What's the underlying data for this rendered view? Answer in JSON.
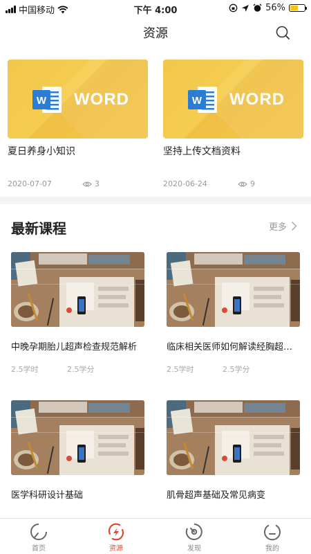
{
  "status_bar": {
    "carrier": "中国移动",
    "time": "下午 4:00",
    "battery_percent": "56%",
    "battery_level": 0.56
  },
  "nav": {
    "title": "资源",
    "search_icon": "search-icon"
  },
  "resources": [
    {
      "thumb_label": "WORD",
      "title": "夏日养身小知识",
      "date": "2020-07-07",
      "views": "3"
    },
    {
      "thumb_label": "WORD",
      "title": "坚持上传文档资料",
      "date": "2020-06-24",
      "views": "9"
    }
  ],
  "section": {
    "title": "最新课程",
    "more_label": "更多"
  },
  "courses": [
    {
      "title": "中晚孕期胎儿超声检查规范解析",
      "hours": "2.5学时",
      "credits": "2.5学分"
    },
    {
      "title": "临床相关医师如何解读经胸超声心动图",
      "hours": "2.5学时",
      "credits": "2.5学分"
    },
    {
      "title": "医学科研设计基础",
      "hours": "",
      "credits": ""
    },
    {
      "title": "肌骨超声基础及常见病变",
      "hours": "",
      "credits": ""
    }
  ],
  "tabs": [
    {
      "label": "首页",
      "icon": "home-icon",
      "active": false
    },
    {
      "label": "资源",
      "icon": "resource-icon",
      "active": true
    },
    {
      "label": "发现",
      "icon": "discover-icon",
      "active": false
    },
    {
      "label": "我的",
      "icon": "profile-icon",
      "active": false
    }
  ],
  "colors": {
    "accent": "#e8452f",
    "card_yellow": "#f3c54a",
    "word_blue": "#2b7cd3",
    "muted": "#999999"
  }
}
